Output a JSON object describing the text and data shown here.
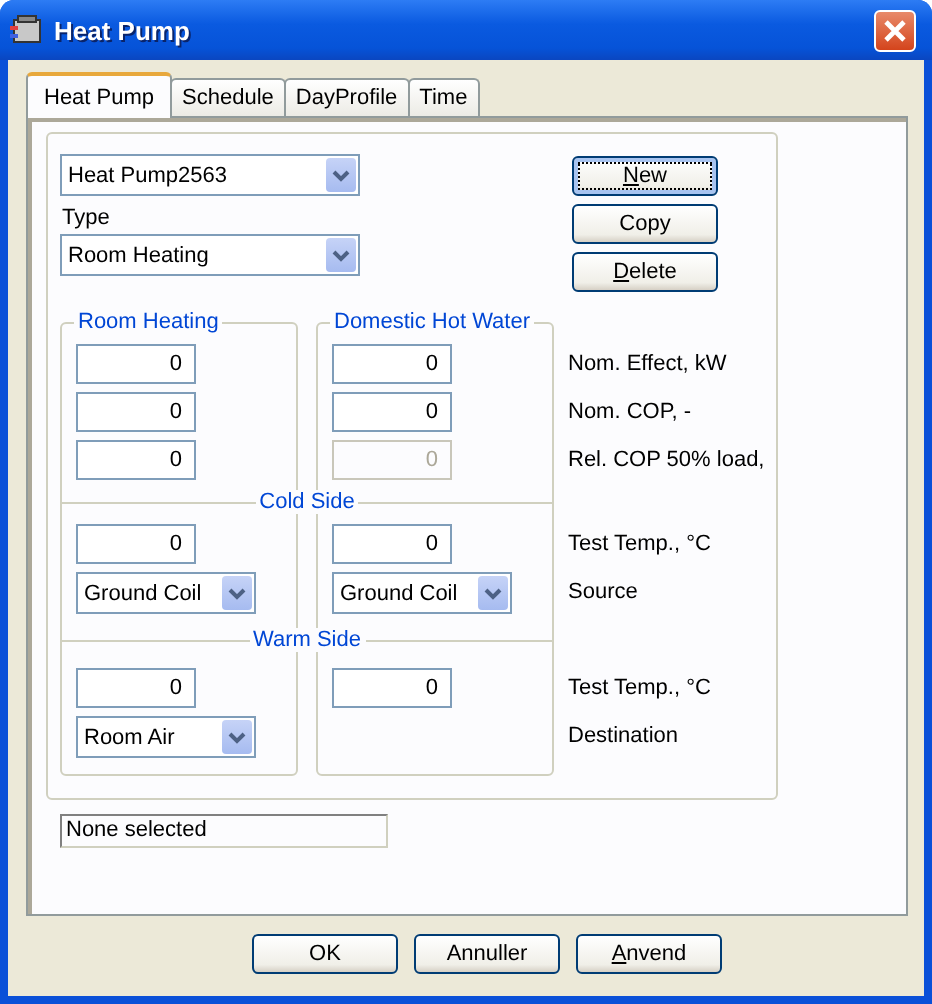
{
  "window": {
    "title": "Heat Pump"
  },
  "tabs": [
    {
      "label": "Heat Pump",
      "selected": true
    },
    {
      "label": "Schedule",
      "selected": false
    },
    {
      "label": "DayProfile",
      "selected": false
    },
    {
      "label": "Time",
      "selected": false
    }
  ],
  "selector": {
    "value": "Heat Pump2563"
  },
  "type_label": "Type",
  "type": {
    "value": "Room Heating"
  },
  "actions": [
    {
      "label": "New",
      "focused": true,
      "mnemonic_first": true
    },
    {
      "label": "Copy",
      "focused": false,
      "mnemonic_first": false
    },
    {
      "label": "Delete",
      "focused": false,
      "mnemonic_first": true
    }
  ],
  "columns": [
    "Room Heating",
    "Domestic Hot Water"
  ],
  "sections": [
    {
      "rows": [
        {
          "label": "Nom. Effect, kW",
          "kind": "field",
          "cells": [
            {
              "value": "0",
              "disabled": false
            },
            {
              "value": "0",
              "disabled": false
            }
          ]
        },
        {
          "label": "Nom. COP, -",
          "kind": "field",
          "cells": [
            {
              "value": "0",
              "disabled": false
            },
            {
              "value": "0",
              "disabled": false
            }
          ]
        },
        {
          "label": "Rel. COP 50% load,",
          "kind": "field",
          "cells": [
            {
              "value": "0",
              "disabled": false
            },
            {
              "value": "0",
              "disabled": true
            }
          ]
        }
      ]
    },
    {
      "title": "Cold Side",
      "rows": [
        {
          "label": "Test Temp., °C",
          "kind": "field",
          "cells": [
            {
              "value": "0",
              "disabled": false
            },
            {
              "value": "0",
              "disabled": false
            }
          ]
        },
        {
          "label": "Source",
          "kind": "combo",
          "cells": [
            {
              "value": "Ground Coil"
            },
            {
              "value": "Ground Coil"
            }
          ]
        }
      ]
    },
    {
      "title": "Warm Side",
      "rows": [
        {
          "label": "Test Temp., °C",
          "kind": "field",
          "cells": [
            {
              "value": "0",
              "disabled": false
            },
            {
              "value": "0",
              "disabled": false
            }
          ]
        },
        {
          "label": "Destination",
          "kind": "combo",
          "cells": [
            {
              "value": "Room Air"
            }
          ]
        }
      ]
    }
  ],
  "status": "None selected",
  "buttons": [
    {
      "label": "OK",
      "mnemonic_first": false
    },
    {
      "label": "Annuller",
      "mnemonic_first": false
    },
    {
      "label": "Anvend",
      "mnemonic_first": true
    }
  ]
}
